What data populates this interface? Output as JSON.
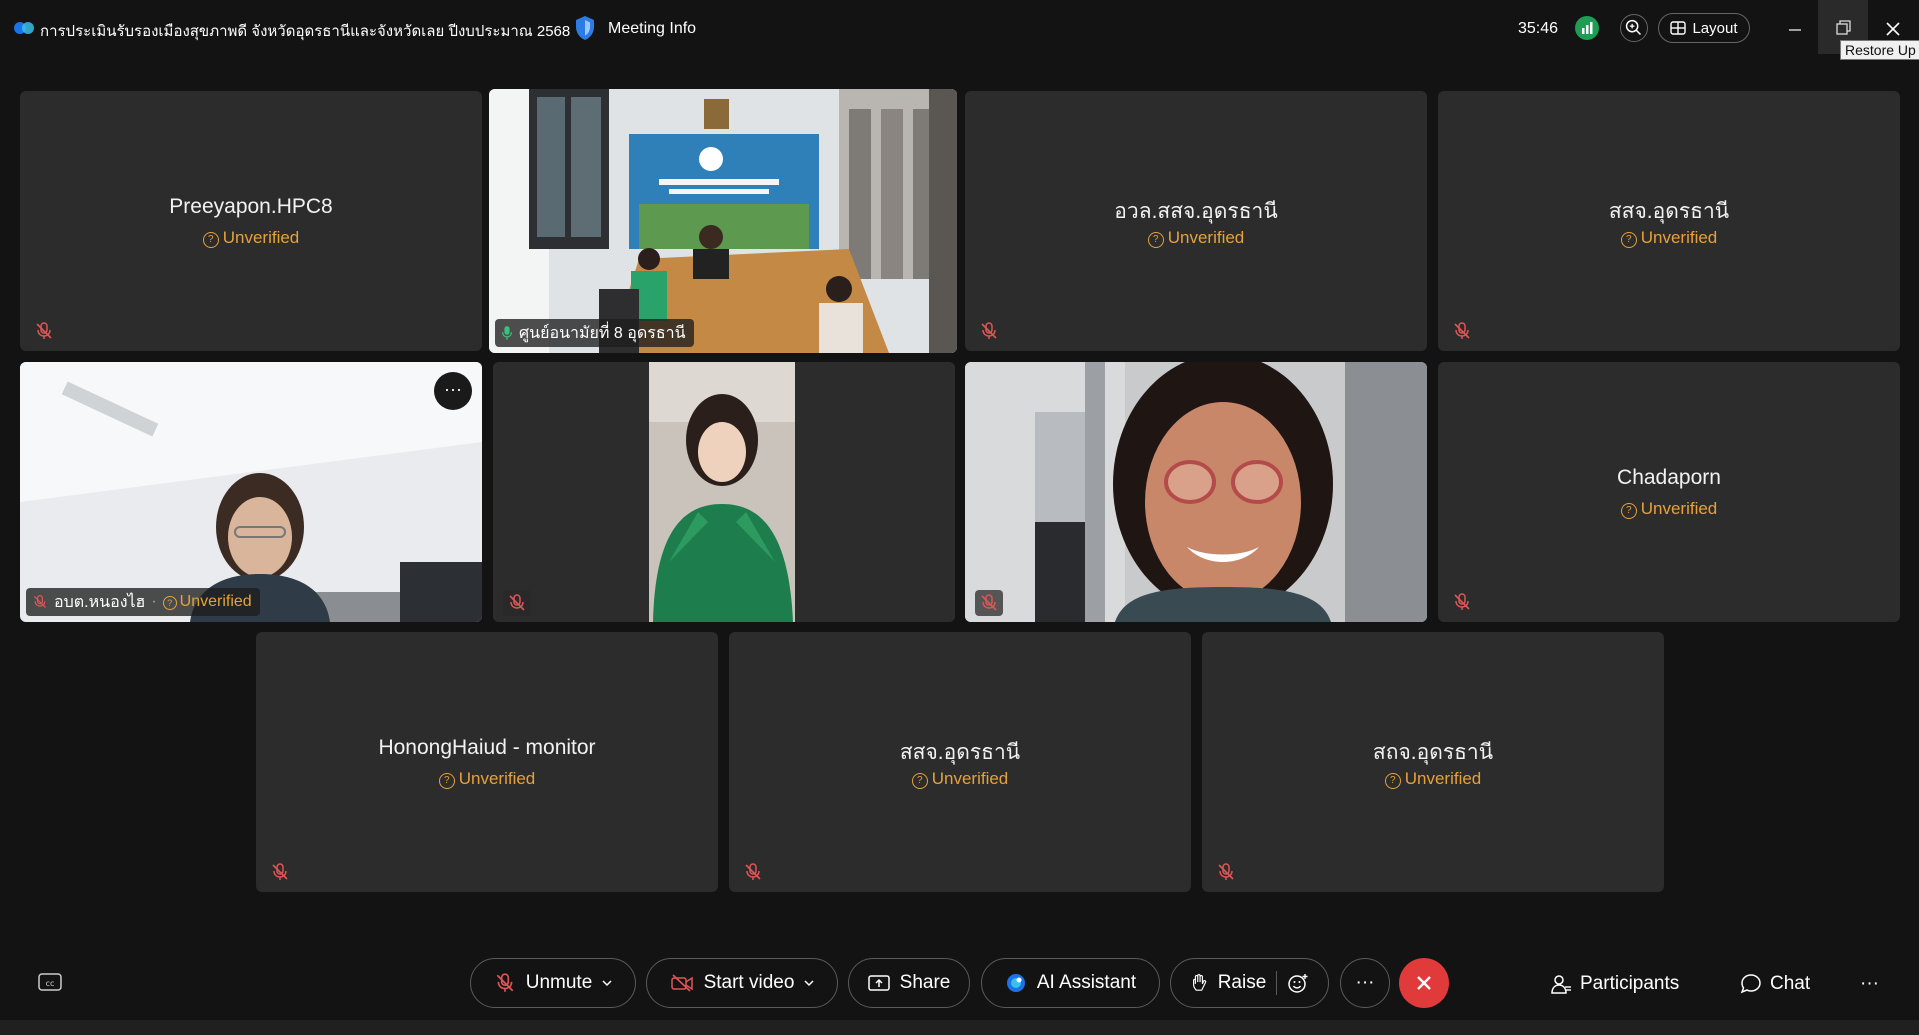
{
  "titlebar": {
    "meeting_title": "การประเมินรับรองเมืองสุขภาพดี จังหวัดอุดรธานีและจังหวัดเลย ปีงบประมาณ 2568",
    "meeting_info_label": "Meeting Info",
    "timer": "35:46",
    "layout_label": "Layout",
    "restore_tooltip": "Restore Up"
  },
  "tiles": [
    {
      "name": "Preeyapon.HPC8",
      "status": "Unverified"
    },
    {
      "name": "ศูนย์อนามัยที่ 8 อุดรธานี"
    },
    {
      "name": "อวล.สสจ.อุดรธานี",
      "status": "Unverified"
    },
    {
      "name": "สสจ.อุดรธานี",
      "status": "Unverified"
    },
    {
      "name": "อบต.หนองไฮ",
      "status": "Unverified"
    },
    {
      "name": ""
    },
    {
      "name": ""
    },
    {
      "name": "Chadaporn",
      "status": "Unverified"
    },
    {
      "name": "HonongHaiud - monitor",
      "status": "Unverified"
    },
    {
      "name": "สสจ.อุดรธานี",
      "status": "Unverified"
    },
    {
      "name": "สถจ.อุดรธานี",
      "status": "Unverified"
    }
  ],
  "toolbar": {
    "unmute_label": "Unmute",
    "start_video_label": "Start video",
    "share_label": "Share",
    "ai_assistant_label": "AI Assistant",
    "raise_label": "Raise",
    "more_label": "···",
    "participants_label": "Participants",
    "chat_label": "Chat",
    "overflow_label": "···"
  },
  "colors": {
    "background": "#131313",
    "tile": "#2c2c2c",
    "unverified": "#e7a13a",
    "active_speaker": "#2bb3a4",
    "end_call": "#e03a3a",
    "signal": "#1f9d55"
  },
  "icons": [
    "webex-logo-icon",
    "shield-icon",
    "zoom-icon",
    "layout-icon",
    "minimize-icon",
    "restore-icon",
    "close-icon",
    "mic-muted-icon",
    "video-off-icon",
    "share-icon",
    "ai-assistant-icon",
    "raise-hand-icon",
    "reaction-icon",
    "end-call-icon",
    "participants-icon",
    "chat-icon",
    "captions-icon"
  ]
}
